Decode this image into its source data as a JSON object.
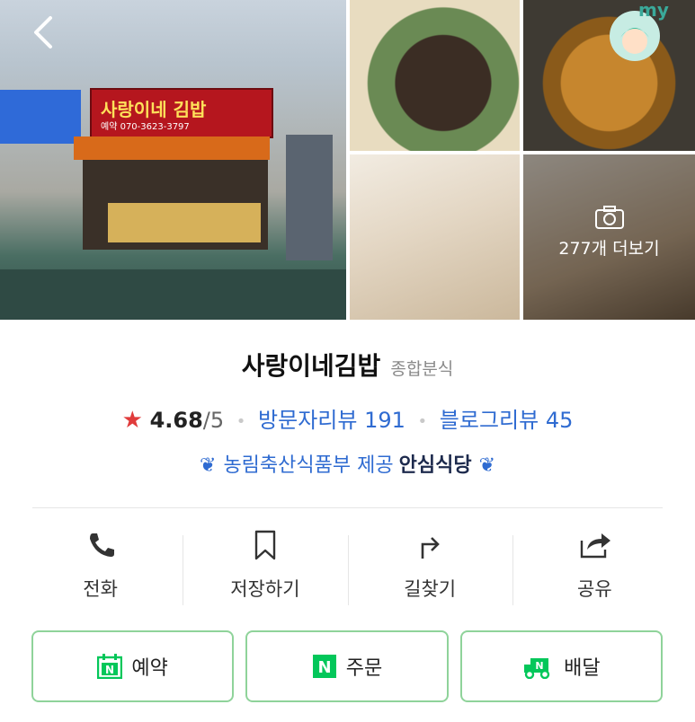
{
  "header": {
    "back_icon": "chevron-left-icon",
    "my_badge": "my",
    "photo_more": "277개 더보기",
    "store_sign_name": "사랑이네 김밥",
    "store_sign_phone": "예약 070-3623-3797"
  },
  "place": {
    "name": "사랑이네김밥",
    "category": "종합분식",
    "rating": "4.68",
    "rating_max": "/5",
    "visitor_reviews": "방문자리뷰 191",
    "blog_reviews": "블로그리뷰 45",
    "cert_provider": "농림축산식품부 제공",
    "cert_badge": "안심식당"
  },
  "actions": [
    {
      "label": "전화",
      "icon": "phone-icon"
    },
    {
      "label": "저장하기",
      "icon": "bookmark-icon"
    },
    {
      "label": "길찾기",
      "icon": "directions-icon"
    },
    {
      "label": "공유",
      "icon": "share-icon"
    }
  ],
  "buttons": [
    {
      "label": "예약",
      "icon": "naver-calendar-icon"
    },
    {
      "label": "주문",
      "icon": "naver-n-icon"
    },
    {
      "label": "배달",
      "icon": "delivery-truck-icon"
    }
  ],
  "colors": {
    "accent_green": "#03c75a",
    "link_blue": "#2f6bd1",
    "star_red": "#e03b3b"
  }
}
